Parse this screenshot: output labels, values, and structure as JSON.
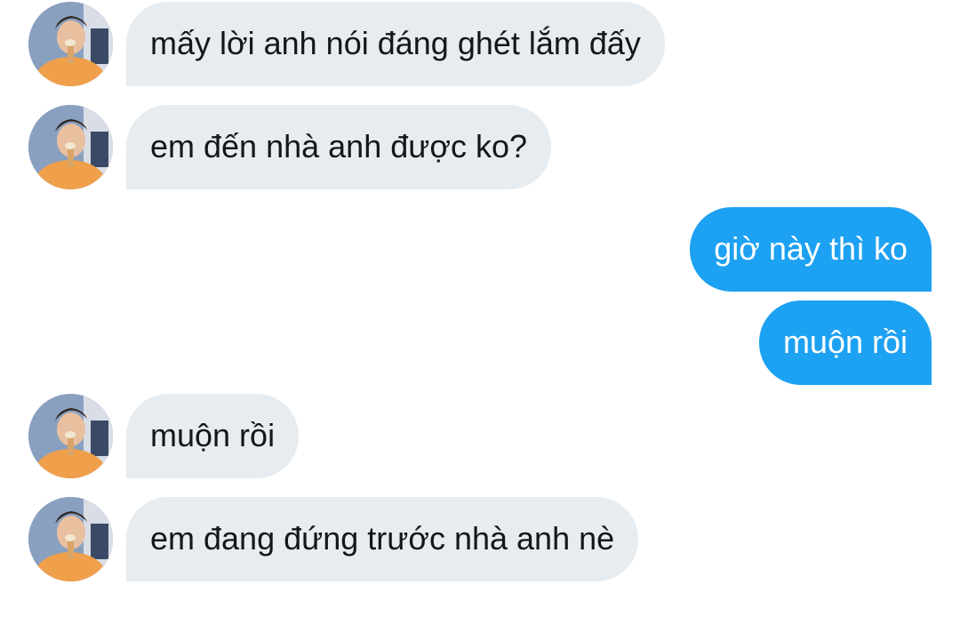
{
  "colors": {
    "incoming_bubble": "#e6ecf0",
    "incoming_text": "#14171a",
    "outgoing_bubble": "#1da1f2",
    "outgoing_text": "#ffffff"
  },
  "conversation": {
    "messages": [
      {
        "sender": "them",
        "text": "mấy lời anh nói đáng ghét lắm đấy"
      },
      {
        "sender": "them",
        "text": "em đến nhà anh được ko?"
      },
      {
        "sender": "me",
        "text": "giờ này thì ko"
      },
      {
        "sender": "me",
        "text": "muộn rồi"
      },
      {
        "sender": "them",
        "text": "muộn rồi"
      },
      {
        "sender": "them",
        "text": "em đang đứng trước nhà anh nè"
      }
    ]
  }
}
